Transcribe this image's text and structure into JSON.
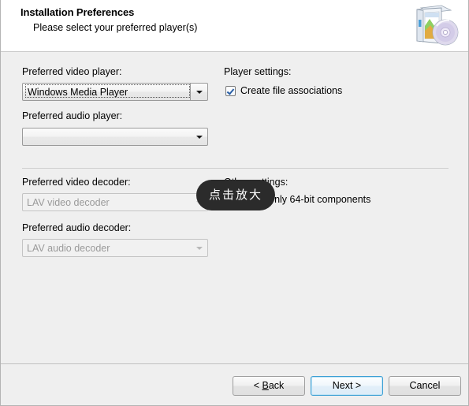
{
  "window": {
    "header": {
      "title": "Installation Preferences",
      "subtitle": "Please select your preferred player(s)",
      "icon": "software-box-cd-icon"
    }
  },
  "main": {
    "left_column": {
      "video_player_label": "Preferred video player:",
      "video_player_value": "Windows Media Player",
      "audio_player_label": "Preferred audio player:",
      "audio_player_value": "",
      "video_decoder_label": "Preferred video decoder:",
      "video_decoder_value": "LAV video decoder",
      "audio_decoder_label": "Preferred audio decoder:",
      "audio_decoder_value": "LAV audio decoder"
    },
    "right_column": {
      "player_settings_label": "Player settings:",
      "create_file_associations_label": "Create file associations",
      "create_file_associations_checked": true,
      "other_settings_label": "Other settings:",
      "install_64bit_label": "Install only 64-bit components",
      "install_64bit_checked": false
    }
  },
  "footer": {
    "back_label_pre": "< ",
    "back_accel": "B",
    "back_label_post": "ack",
    "next_label": "Next >",
    "cancel_label": "Cancel"
  },
  "overlay": {
    "zoom_badge_label": "点击放大"
  },
  "colors": {
    "accent_default_button": "#3c9fd4",
    "checkmark": "#2a5fa5",
    "body_background": "#efefef",
    "header_background": "#ffffff",
    "overlay_background": "#2b2b2b"
  }
}
